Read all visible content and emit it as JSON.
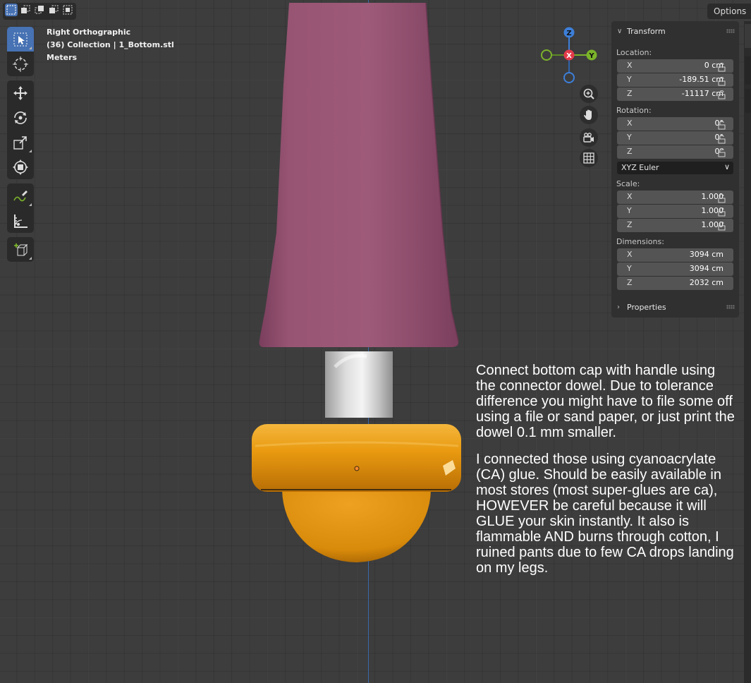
{
  "header": {
    "options_label": "Options"
  },
  "viewport_info": {
    "view_name": "Right Orthographic",
    "collection": "(36) Collection | 1_Bottom.stl",
    "units": "Meters"
  },
  "gizmo": {
    "x_label": "X",
    "y_label": "Y",
    "z_label": "Z"
  },
  "panel": {
    "transform_title": "Transform",
    "location_label": "Location:",
    "location": [
      {
        "axis": "X",
        "value": "0 cm"
      },
      {
        "axis": "Y",
        "value": "-189.51 cm"
      },
      {
        "axis": "Z",
        "value": "-11117 cm"
      }
    ],
    "rotation_label": "Rotation:",
    "rotation": [
      {
        "axis": "X",
        "value": "0°"
      },
      {
        "axis": "Y",
        "value": "0°"
      },
      {
        "axis": "Z",
        "value": "0°"
      }
    ],
    "rotation_mode": "XYZ Euler",
    "scale_label": "Scale:",
    "scale": [
      {
        "axis": "X",
        "value": "1.000"
      },
      {
        "axis": "Y",
        "value": "1.000"
      },
      {
        "axis": "Z",
        "value": "1.000"
      }
    ],
    "dimensions_label": "Dimensions:",
    "dimensions": [
      {
        "axis": "X",
        "value": "3094 cm"
      },
      {
        "axis": "Y",
        "value": "3094 cm"
      },
      {
        "axis": "Z",
        "value": "2032 cm"
      }
    ],
    "properties_title": "Properties"
  },
  "notes": {
    "paragraph1": "Connect bottom cap with handle using the connector dowel. Due to tolerance difference you might have to file some off using a file or sand paper, or just print the dowel 0.1 mm smaller.",
    "paragraph2": "I connected those using cyanoacrylate  (CA) glue. Should be easily available in most stores (most super-glues are ca), HOWEVER be careful because it will GLUE your skin instantly. It also is flammable AND burns through cotton, I ruined pants due to few CA drops landing on my legs."
  },
  "colors": {
    "handle": "#9a5577",
    "cap": "#e79a12",
    "dowel": "#b8b8b8",
    "active_tool": "#4772b3",
    "gizmo_x": "#e33a4a",
    "gizmo_y": "#7bb32a",
    "gizmo_z": "#3d7fd9"
  }
}
